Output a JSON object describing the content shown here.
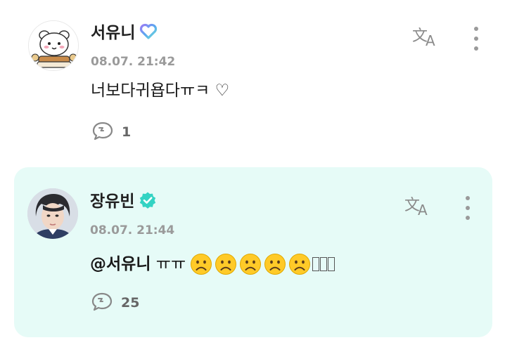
{
  "comments": [
    {
      "author": "서유니",
      "timestamp": "08.07. 21:42",
      "text": "너보다귀욥다ㅠㅋ ♡",
      "reply_count": "1",
      "badge_icon": "heart-badge-icon"
    },
    {
      "author": "장유빈",
      "timestamp": "08.07. 21:44",
      "mention": "@서유니",
      "text_suffix": " ㅠㅠ",
      "emoji_icon": "frowning-face-icon",
      "emoji_count": 5,
      "reply_count": "25",
      "badge_icon": "verified-check-icon",
      "highlight_color": "#e6fbf7"
    }
  ],
  "colors": {
    "verified": "#33d3c3",
    "muted": "#9a9a9a"
  }
}
